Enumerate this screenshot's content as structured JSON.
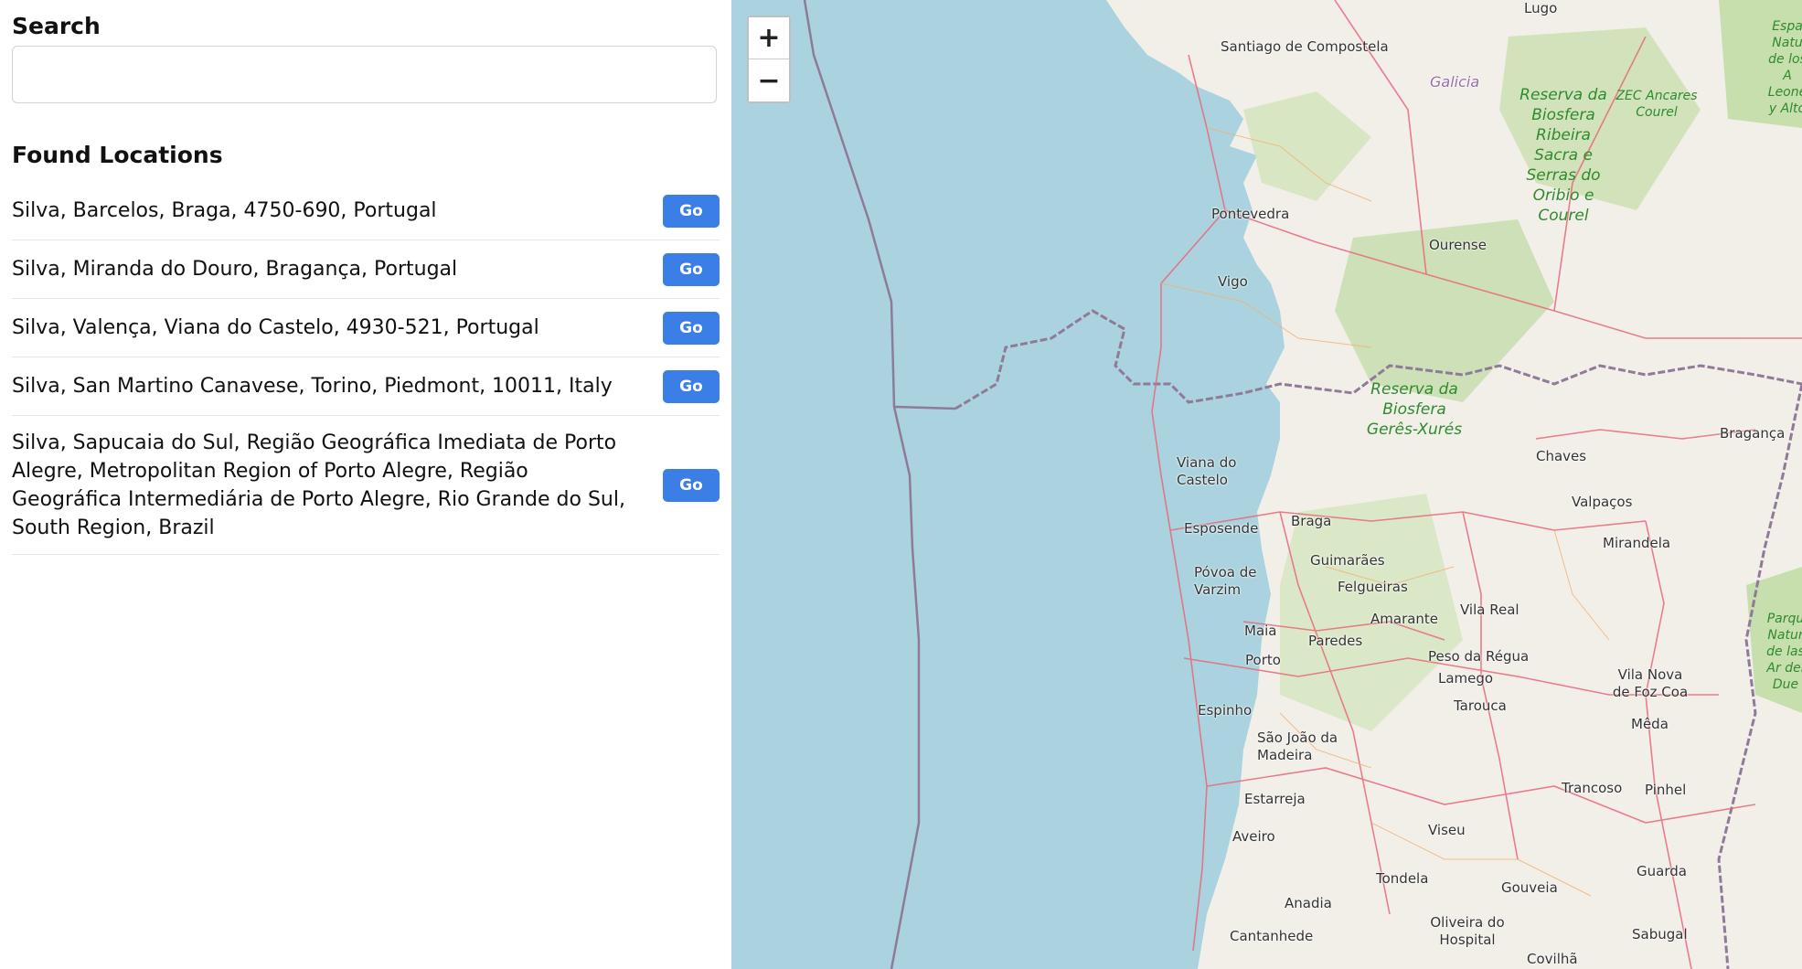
{
  "search": {
    "label": "Search",
    "value": "",
    "placeholder": ""
  },
  "results": {
    "title": "Found Locations",
    "go_label": "Go",
    "items": [
      {
        "text": "Silva, Barcelos, Braga, 4750-690, Portugal"
      },
      {
        "text": "Silva, Miranda do Douro, Bragança, Portugal"
      },
      {
        "text": "Silva, Valença, Viana do Castelo, 4930-521, Portugal"
      },
      {
        "text": "Silva, San Martino Canavese, Torino, Piedmont, 10011, Italy"
      },
      {
        "text": "Silva, Sapucaia do Sul, Região Geográfica Imediata de Porto Alegre, Metropolitan Region of Porto Alegre, Região Geográfica Intermediária de Porto Alegre, Rio Grande do Sul, South Region, Brazil"
      }
    ]
  },
  "map": {
    "zoom_in": "+",
    "zoom_out": "−",
    "colors": {
      "sea": "#aad3df",
      "land": "#f2efe9",
      "border": "#8f7a9a",
      "roads": "#e8697a"
    },
    "labels": [
      "Lugo",
      "Santiago de Compostela",
      "Galicia",
      "Pontevedra",
      "Ourense",
      "Vigo",
      "Viana do Castelo",
      "Esposende",
      "Braga",
      "Guimarães",
      "Póvoa de Varzim",
      "Felgueiras",
      "Maia",
      "Paredes",
      "Amarante",
      "Porto",
      "Vila Real",
      "Chaves",
      "Valpaços",
      "Mirandela",
      "Bragança",
      "Peso da Régua",
      "Lamego",
      "Espinho",
      "Tarouca",
      "São João da Madeira",
      "Vila Nova de Foz Coa",
      "Mêda",
      "Estarreja",
      "Trancoso",
      "Pinhel",
      "Aveiro",
      "Viseu",
      "Tondela",
      "Gouveia",
      "Guarda",
      "Anadia",
      "Oliveira do Hospital",
      "Cantanhede",
      "Sabugal",
      "Covilhã"
    ],
    "green_labels": [
      "Reserva da Biosfera Ribeira Sacra e Serras do Oribio e Courel",
      "ZEC Ancares Courel",
      "Reserva da Biosfera Gerês-Xurés",
      "Espa Natu de los A Leone y Alto",
      "Parqu Natur de las Ar del Due"
    ]
  }
}
